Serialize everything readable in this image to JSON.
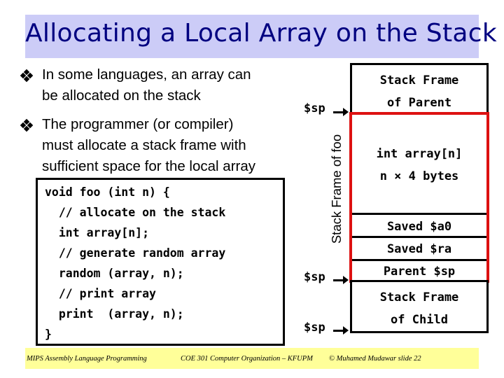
{
  "slide": {
    "title": "Allocating a Local Array on the Stack",
    "bullets": [
      {
        "icon": "diamond-bullet-icon",
        "lines": [
          "In some languages, an array can",
          "be allocated on the stack"
        ]
      },
      {
        "icon": "diamond-bullet-icon",
        "lines": [
          "The programmer (or compiler)",
          "must allocate a stack frame with",
          "sufficient space for the local array"
        ]
      }
    ],
    "code": [
      "void foo (int n) {",
      "  // allocate on the stack",
      "  int array[n];",
      "  // generate random array",
      "  random (array, n);",
      "  // print array",
      "  print  (array, n);",
      "}"
    ]
  },
  "diagram": {
    "parent_frame": [
      "Stack Frame",
      "of Parent"
    ],
    "foo_frame_label": "Stack Frame of foo",
    "foo_frame_color": "#dd1111",
    "array_cell": [
      "int array[n]",
      "n × 4 bytes"
    ],
    "saved_a0": "Saved $a0",
    "saved_ra": "Saved $ra",
    "parent_sp": "Parent $sp",
    "child_frame": [
      "Stack Frame",
      "of Child"
    ],
    "sp_labels": [
      "$sp",
      "$sp",
      "$sp"
    ]
  },
  "footer": {
    "left": "MIPS Assembly Language Programming",
    "center": "COE 301 Computer Organization – KFUPM",
    "right": "© Muhamed Mudawar   slide 22"
  },
  "colors": {
    "title_band": "#ccccf7",
    "title_text": "#000080",
    "footer_band": "#ffff99"
  }
}
